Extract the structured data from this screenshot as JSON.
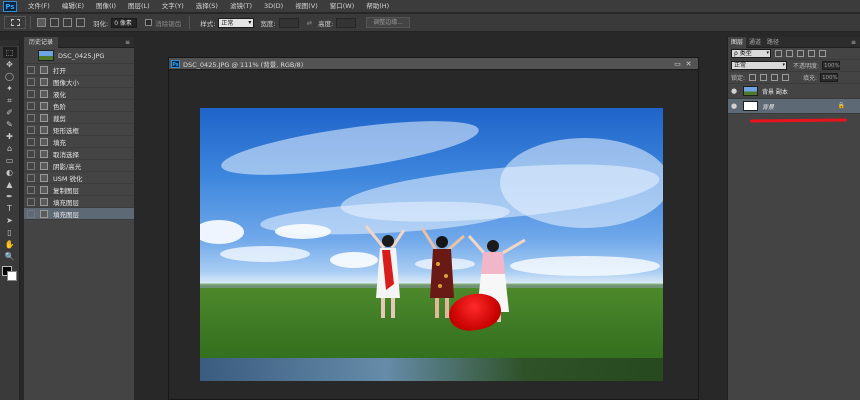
{
  "app": {
    "logo": "Ps"
  },
  "menu": [
    "文件(F)",
    "编辑(E)",
    "图像(I)",
    "图层(L)",
    "文字(Y)",
    "选择(S)",
    "滤镜(T)",
    "3D(D)",
    "视图(V)",
    "窗口(W)",
    "帮助(H)"
  ],
  "options": {
    "feather_label": "羽化:",
    "feather_value": "0 像素",
    "antialias_label": "消除锯齿",
    "style_label": "样式:",
    "style_value": "正常",
    "width_label": "宽度:",
    "height_label": "高度:",
    "swap_icon": "⇄",
    "refine_edge": "调整边缘..."
  },
  "tools": [
    "⬚",
    "✥",
    "◯",
    "✦",
    "⌗",
    "✐",
    "✎",
    "✚",
    "⌂",
    "▭",
    "◐",
    "▲",
    "✒",
    "T",
    "➤",
    "▯",
    "✋",
    "🔍"
  ],
  "history": {
    "tab": "历史记录",
    "snapshot": "DSC_0425.JPG",
    "items": [
      "打开",
      "图像大小",
      "液化",
      "色阶",
      "裁剪",
      "矩形选框",
      "填充",
      "取消选择",
      "阴影/高光",
      "USM 锐化",
      "复制图层",
      "填充图层",
      "填充图层"
    ]
  },
  "document": {
    "tab": "DSC_0425.JPG @ 111% (背景, RGB/8)",
    "minimize": "▭",
    "close": "✕"
  },
  "layers": {
    "tabs": [
      "图层",
      "通道",
      "路径"
    ],
    "filter_kind": "ρ 类型",
    "blend_mode": "正常",
    "opacity_label": "不透明度:",
    "opacity_value": "100%",
    "lock_label": "锁定:",
    "fill_label": "填充:",
    "fill_value": "100%",
    "items": [
      {
        "name": "背景 副本",
        "thumb": "photo"
      },
      {
        "name": "背景",
        "thumb": "white",
        "locked": true
      }
    ]
  },
  "colors": {
    "accent_red": "#e8141d",
    "foreground": "#000000",
    "background": "#ffffff"
  }
}
